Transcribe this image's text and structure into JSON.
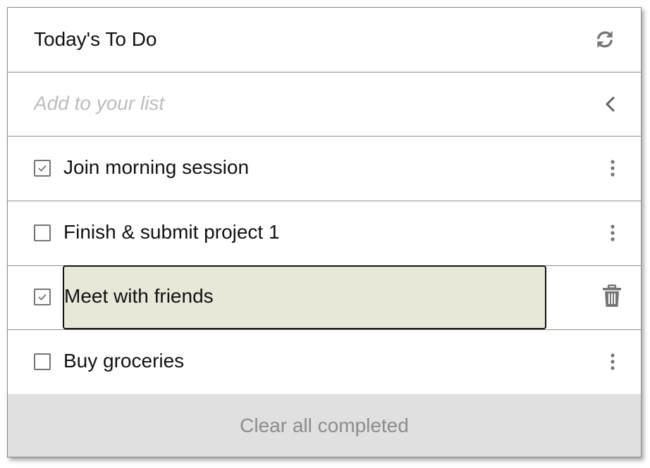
{
  "header": {
    "title": "Today's To Do",
    "refresh_icon": "refresh-icon"
  },
  "add": {
    "placeholder": "Add to your list",
    "collapse_icon": "chevron-left-icon"
  },
  "items": [
    {
      "label": "Join morning session",
      "checked": true,
      "action_icon": "more-vert-icon"
    },
    {
      "label": "Finish & submit project 1",
      "checked": false,
      "action_icon": "more-vert-icon"
    },
    {
      "label": "Meet with friends",
      "checked": true,
      "editing": true,
      "action_icon": "trash-icon"
    },
    {
      "label": "Buy groceries",
      "checked": false,
      "action_icon": "more-vert-icon"
    }
  ],
  "footer": {
    "clear_label": "Clear all completed"
  },
  "colors": {
    "border": "#8f8f8f",
    "edit_background": "#e8e8d9",
    "footer_background": "#e0e0e0",
    "footer_text": "#8c8c8c",
    "icon": "#757575",
    "placeholder": "#bdbdbd"
  }
}
